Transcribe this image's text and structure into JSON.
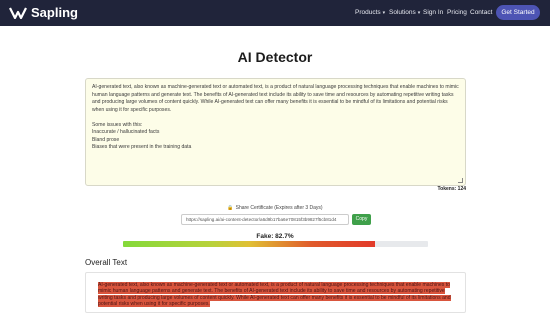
{
  "brand": {
    "name": "Sapling"
  },
  "nav": {
    "items": [
      {
        "label": "Products",
        "caret": "▾"
      },
      {
        "label": "Solutions",
        "caret": "▾"
      },
      {
        "label": "Sign In"
      },
      {
        "label": "Pricing"
      },
      {
        "label": "Contact"
      }
    ],
    "cta": "Get Started"
  },
  "page": {
    "title": "AI Detector"
  },
  "editor": {
    "text": "AI-generated text, also known as machine-generated text or automated text, is a product of natural language processing techniques that enable machines to mimic human language patterns and generate text. The benefits of AI-generated text include its ability to save time and resources by automating repetitive writing tasks and producing large volumes of content quickly. While AI-generated text can offer many benefits it is essential to be mindful of its limitations and potential risks when using it for specific purposes.\n\nSome issues with this:\nInaccurate / hallucinated facts\nBland prose\nBiases that were present in the training data"
  },
  "tokens": "Tokens: 124",
  "share": {
    "label": "Share Certificate (Expires after 3 Days)",
    "url": "https://sapling.ai/ai-content-detector/a6d9b17ba6e70815f3b9827f5cb81d4",
    "copy": "Copy"
  },
  "score": {
    "label": "Fake: 82.7%",
    "fraction": 0.827
  },
  "overall": {
    "title": "Overall Text",
    "highlighted": "AI-generated text, also known as machine-generated text or automated text, is a product of natural language processing techniques that enable machines to mimic human language patterns and generate text. The benefits of AI-generated text include its ability to save time and resources by automating repetitive writing tasks and producing large volumes of content quickly. While AI-generated text can offer many benefits it is essential to be mindful of its limitations and potential risks when using it for specific purposes."
  },
  "colors": {
    "navbar": "#20243a",
    "cta": "#4d54b4",
    "copy": "#3fa04a",
    "highlight": "#d9553d"
  }
}
